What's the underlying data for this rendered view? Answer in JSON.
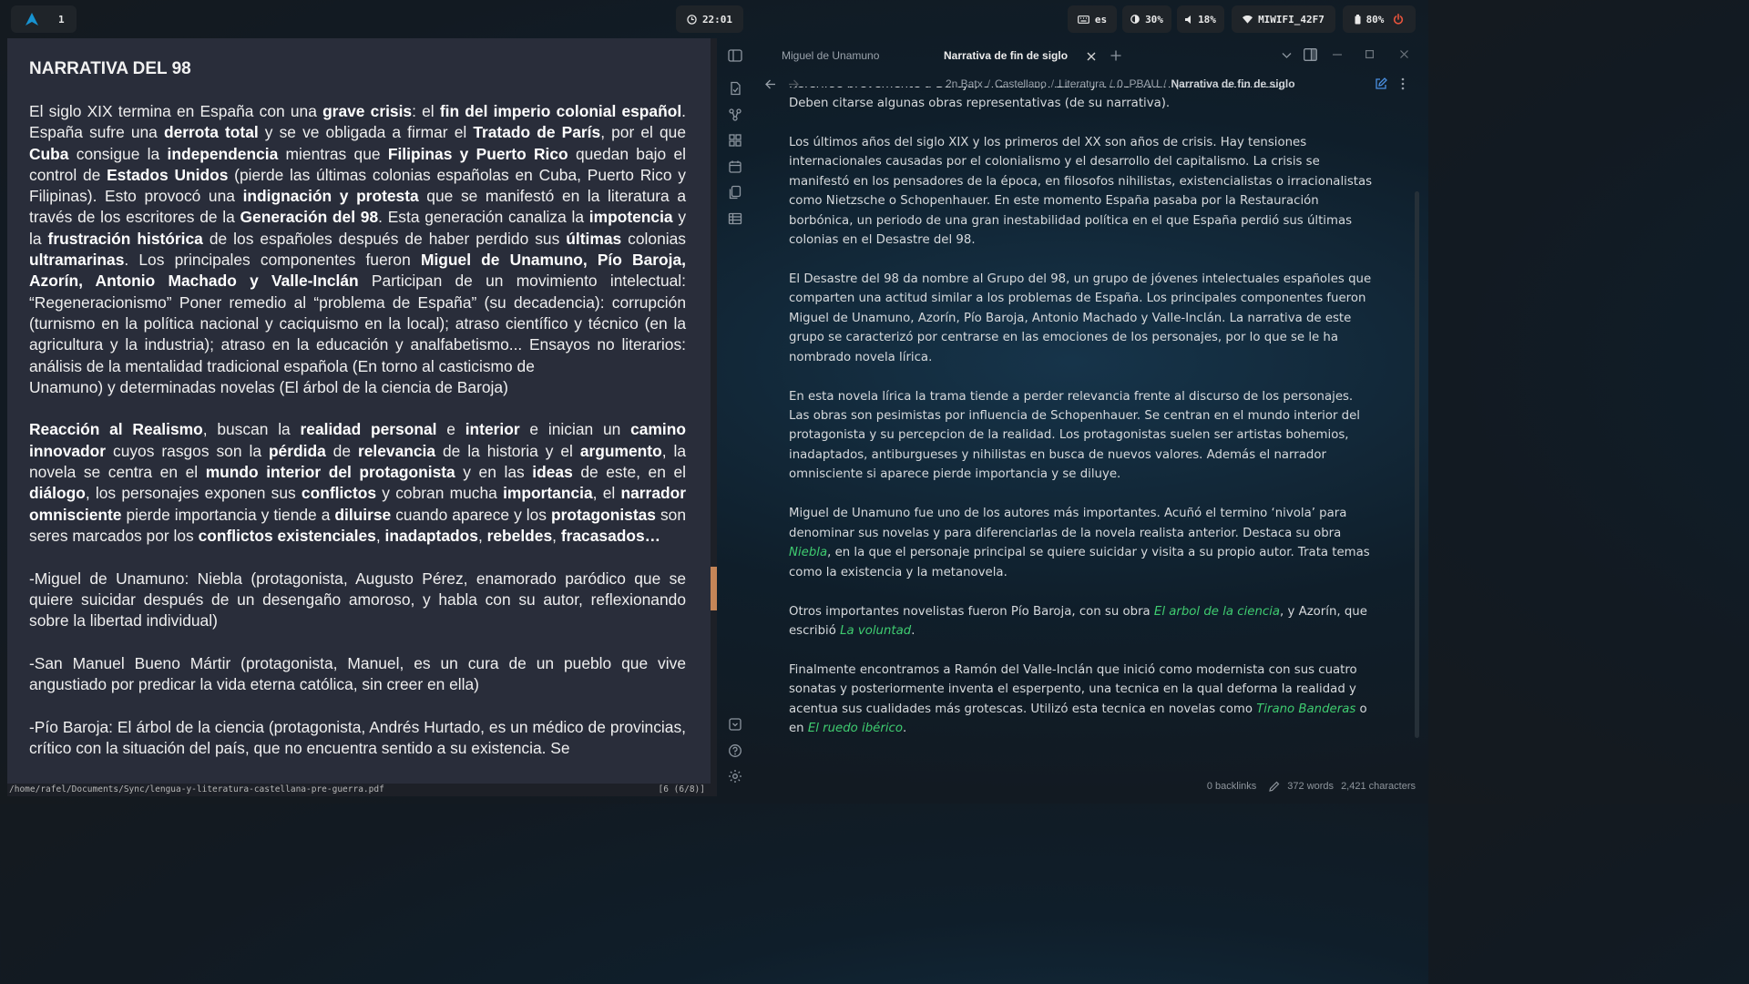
{
  "topbar": {
    "workspace": "1",
    "clock": "22:01",
    "keyboard": "es",
    "brightness": "30%",
    "volume": "18%",
    "wifi": "MIWIFI_42F7",
    "battery": "80%"
  },
  "pdf": {
    "title": "NARRATIVA DEL 98",
    "status_path": "/home/rafel/Documents/Sync/lengua-y-literatura-castellana-pre-guerra.pdf",
    "status_page": "[6 (6/8)]",
    "p1": [
      "El siglo XIX termina en España con una ",
      "grave crisis",
      ": el ",
      "fin del imperio colonial español",
      ". España sufre una ",
      "derrota total",
      " y se ve obligada a firmar el ",
      "Tratado de París",
      ", por el que ",
      "Cuba",
      " consigue la ",
      "independencia",
      " mientras que ",
      "Filipinas y Puerto Rico",
      " quedan bajo el control de ",
      "Estados Unidos",
      " (pierde las últimas colonias españolas en Cuba, Puerto Rico y Filipinas). Esto provocó una ",
      "indignación y protesta",
      " que se manifestó en la literatura a través de los escritores de la ",
      "Generación del 98",
      ". Esta generación canaliza la ",
      "impotencia",
      " y la ",
      "frustración histórica",
      " de los españoles después de haber perdido sus ",
      "últimas",
      " colonias ",
      "ultramarinas",
      ". Los principales componentes fueron ",
      "Miguel de Unamuno, Pío Baroja, Azorín, Antonio Machado y Valle-Inclán",
      " Participan de un movimiento intelectual: “Regeneracionismo” Poner remedio al “problema de España” (su decadencia): corrupción (turnismo en la política nacional y caciquismo en la local); atraso científico y técnico (en la agricultura y la industria); atraso en la educación y analfabetismo... Ensayos no literarios: análisis de la mentalidad tradicional española (En torno al casticismo de",
      "Unamuno) y determinadas novelas (El árbol de la ciencia de Baroja)"
    ],
    "p2": [
      " ",
      "Reacción al Realismo",
      ", buscan la ",
      "realidad personal",
      " e ",
      "interior",
      " e inician un ",
      "camino innovador",
      " cuyos rasgos son la ",
      "pérdida",
      " de ",
      "relevancia",
      " de la historia y el ",
      "argumento",
      ", la novela se centra en el ",
      "mundo interior del protagonista",
      " y en las ",
      "ideas",
      " de este, en el ",
      "diálogo",
      ", los personajes exponen sus ",
      "conflictos",
      " y cobran mucha ",
      "importancia",
      ", el ",
      "narrador omnisciente",
      " pierde importancia y tiende a ",
      "diluirse",
      " cuando aparece y los ",
      "protagonistas",
      " son seres marcados por los ",
      "conflictos existenciales",
      ", ",
      "inadaptados",
      ", ",
      "rebeldes",
      ", ",
      "fracasados…"
    ],
    "p3": "-Miguel de Unamuno: Niebla (protagonista, Augusto Pérez, enamorado paródico que se quiere suicidar después de un desengaño amoroso, y habla con su autor, reflexionando sobre la libertad individual)",
    "p4": "-San Manuel Bueno Mártir (protagonista, Manuel, es un cura de un pueblo que vive angustiado por predicar la vida eterna católica, sin creer en ella)",
    "p5": "-Pío Baroja: El árbol de la ciencia (protagonista, Andrés Hurtado, es un médico de provincias, crítico con la situación del país, que no encuentra sentido a su existencia. Se"
  },
  "obsidian": {
    "tab_inactive": "Miguel de Unamuno",
    "tab_active": "Narrativa de fin de siglo",
    "breadcrumbs": [
      "2n Batx",
      "Castellano",
      "Literatura",
      "0. PBAU",
      "Narrativa de fin de siglo"
    ],
    "cut_line": "Referirse brevemente a Baroja, Unamuno, Azorín y Valle-Inclán (como novelistas).",
    "line2": "Deben citarse algunas obras representativas (de su narrativa).",
    "p1": "Los últimos años del siglo XIX y los primeros del XX son años de crisis. Hay tensiones internacionales causadas por el colonialismo y el desarrollo del capitalismo. La crisis se manifestó en los pensadores de la época, en filosofos nihilistas, existencialistas o irracionalistas como Nietzsche o Schopenhauer. En este momento España pasaba por la Restauración borbónica, un periodo de una gran inestabilidad política en el que España perdió sus últimas colonias en el Desastre del 98.",
    "p2": "El Desastre del 98 da nombre al Grupo del 98, un grupo de jóvenes intelectuales españoles que comparten una actitud similar a los problemas de España. Los principales componentes fueron Miguel de Unamuno, Azorín, Pío Baroja, Antonio Machado y Valle-Inclán. La narrativa de este grupo se caracterizó por centrarse en las emociones de los personajes, por lo que se le ha nombrado novela lírica.",
    "p3": "En esta novela lírica la trama tiende a perder relevancia frente al discurso de los personajes. Las obras son pesimistas por influencia de Schopenhauer. Se centran en el mundo interior del protagonista y su percepcion de la realidad. Los protagonistas suelen ser artistas bohemios, inadaptados, antiburgueses y nihilistas en busca de nuevos valores. Además el narrador omnisciente si aparece pierde importancia y se diluye.",
    "p4a": "Miguel de Unamuno fue uno de los autores más importantes. Acuñó el termino ‘nivola’ para denominar sus novelas y para diferenciarlas de la novela realista anterior. Destaca su obra ",
    "p4_link": "Niebla",
    "p4b": ", en la que el personaje principal se quiere suicidar y visita a su propio autor. Trata temas como la existencia y la metanovela.",
    "p5a": "Otros importantes novelistas fueron Pío Baroja, con su obra ",
    "p5_link1": "El arbol de la ciencia",
    "p5b": ", y Azorín, que escribió ",
    "p5_link2": "La voluntad",
    "p5c": ".",
    "p6a": "Finalmente encontramos a Ramón del Valle-Inclán que inició como modernista con sus cuatro sonatas y posteriormente inventa el esperpento, una tecnica en la qual deforma la realidad y acentua sus cualidades más grotescas. Utilizó esta tecnica en novelas como ",
    "p6_link1": "Tirano Banderas",
    "p6b": " o en ",
    "p6_link2": "El ruedo ibérico",
    "p6c": ".",
    "backlinks": "0 backlinks",
    "words": "372 words",
    "chars": "2,421 characters"
  },
  "colors": {
    "link": "#3fcc70",
    "power": "#e5533c",
    "pdf_bg": "#292d3a",
    "accent_blue": "#4a90e2"
  }
}
